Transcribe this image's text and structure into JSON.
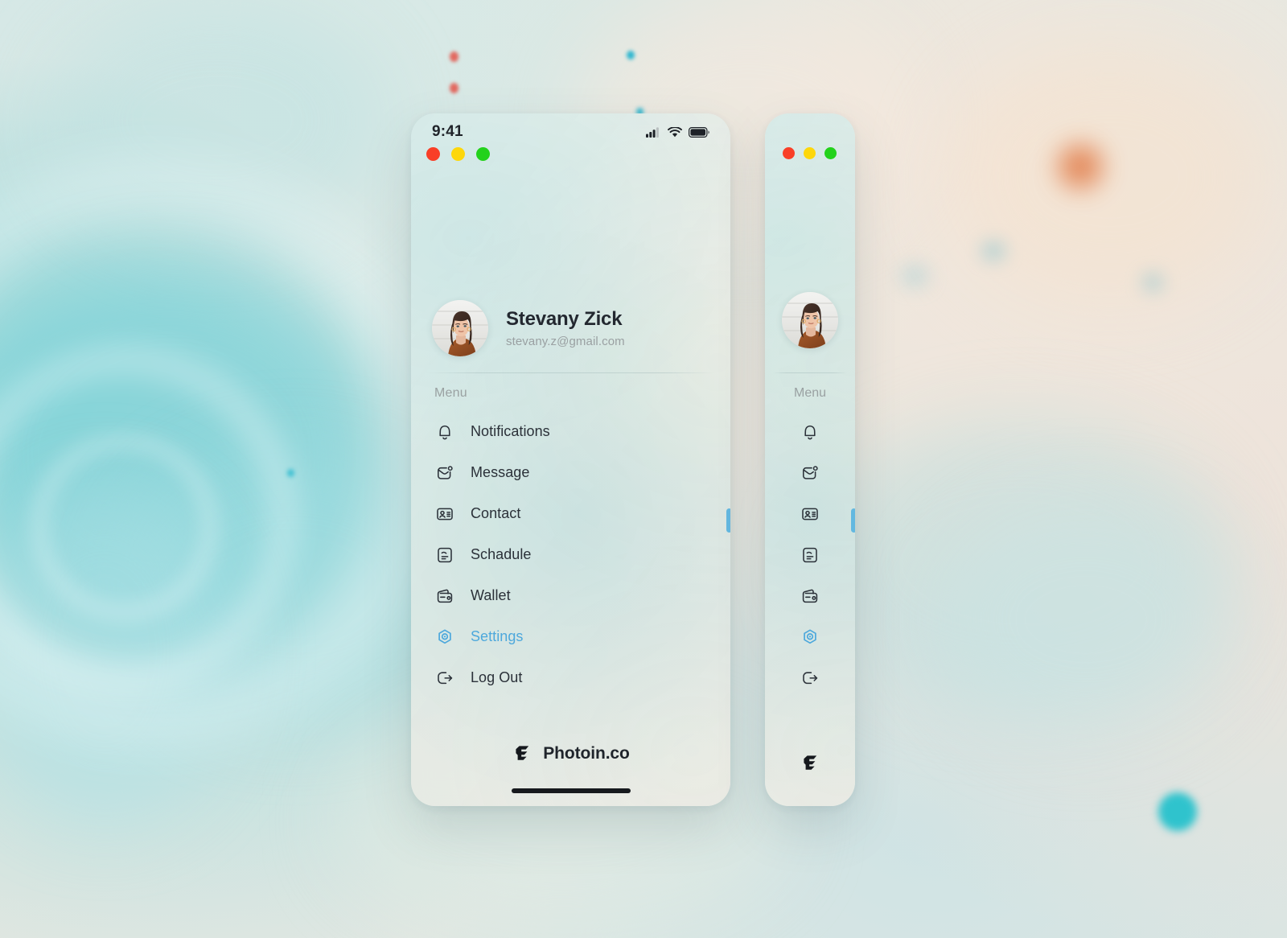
{
  "background": {
    "description": "pale teal and cream marbled watercolor texture",
    "accent_teal": "#2fc3cd",
    "accent_orange": "#e0733c",
    "accent_red": "#e2685f"
  },
  "statusbar": {
    "time": "9:41",
    "icons": [
      "cellular-signal-icon",
      "wifi-icon",
      "battery-icon"
    ]
  },
  "window_controls": {
    "close_label": "",
    "minimize_label": "",
    "maximize_label": "",
    "colors": {
      "close": "#f93f27",
      "minimize": "#fdd70b",
      "maximize": "#23d21b"
    }
  },
  "profile": {
    "name": "Stevany Zick",
    "email": "stevany.z@gmail.com",
    "avatar_alt": "Stevany Zick portrait"
  },
  "menu": {
    "section_label": "Menu",
    "active_color": "#4da8dc",
    "items": [
      {
        "label": "Notifications",
        "icon": "bell-icon",
        "active": false
      },
      {
        "label": "Message",
        "icon": "message-icon",
        "active": false
      },
      {
        "label": "Contact",
        "icon": "contact-card-icon",
        "active": false
      },
      {
        "label": "Schadule",
        "icon": "schedule-document-icon",
        "active": false
      },
      {
        "label": "Wallet",
        "icon": "wallet-icon",
        "active": false
      },
      {
        "label": "Settings",
        "icon": "settings-gear-icon",
        "active": true
      },
      {
        "label": "Log Out",
        "icon": "logout-icon",
        "active": false
      }
    ]
  },
  "footer": {
    "brand_name": "Photoin.co",
    "brand_mark": "photoin-logo-icon"
  }
}
